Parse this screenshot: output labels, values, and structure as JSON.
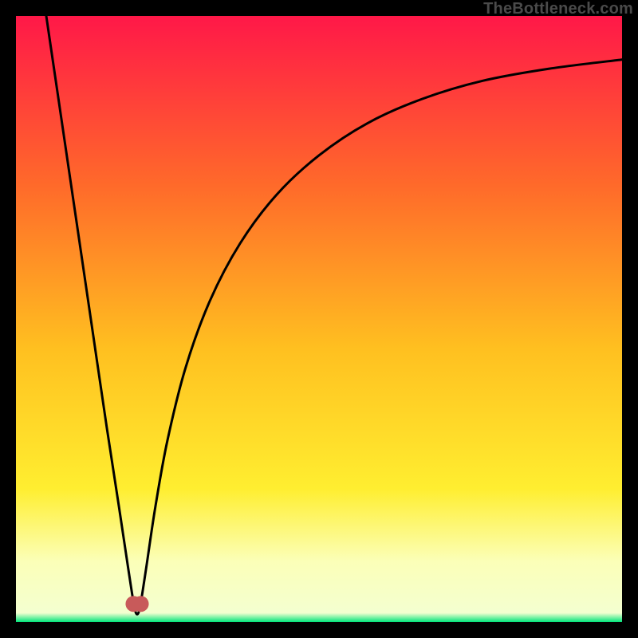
{
  "credit": "TheBottleneck.com",
  "colors": {
    "top": "#ff1848",
    "upper_mid": "#ff6a2a",
    "mid": "#ffc020",
    "lower_mid": "#ffee30",
    "pale": "#fbffb8",
    "green": "#00e47a",
    "curve": "#000000",
    "marker": "#c85a5a"
  },
  "chart_data": {
    "type": "line",
    "title": "",
    "xlabel": "",
    "ylabel": "",
    "xlim": [
      0,
      100
    ],
    "ylim": [
      0,
      100
    ],
    "series": [
      {
        "name": "bottleneck-curve",
        "x": [
          5.0,
          7.5,
          10.0,
          12.5,
          15.0,
          17.0,
          18.5,
          19.4,
          19.8,
          20.2,
          20.6,
          21.5,
          23.0,
          25.0,
          28.0,
          32.0,
          37.0,
          43.0,
          50.0,
          58.0,
          67.0,
          77.0,
          88.0,
          100.0
        ],
        "y": [
          100.0,
          83.0,
          66.0,
          49.0,
          32.0,
          19.0,
          9.0,
          3.2,
          1.5,
          1.5,
          3.2,
          9.0,
          19.0,
          30.0,
          42.0,
          53.0,
          62.5,
          70.5,
          77.0,
          82.3,
          86.3,
          89.3,
          91.3,
          92.8
        ]
      }
    ],
    "markers": [
      {
        "name": "valley-left",
        "x": 19.4,
        "y": 3.0
      },
      {
        "name": "valley-right",
        "x": 20.6,
        "y": 3.0
      }
    ],
    "gradient_stops": [
      {
        "pos": 0.0,
        "color": "#ff1848"
      },
      {
        "pos": 0.28,
        "color": "#ff6a2a"
      },
      {
        "pos": 0.55,
        "color": "#ffc020"
      },
      {
        "pos": 0.78,
        "color": "#ffee30"
      },
      {
        "pos": 0.9,
        "color": "#fbffb8"
      },
      {
        "pos": 0.985,
        "color": "#f4ffd0"
      },
      {
        "pos": 1.0,
        "color": "#00e47a"
      }
    ]
  }
}
